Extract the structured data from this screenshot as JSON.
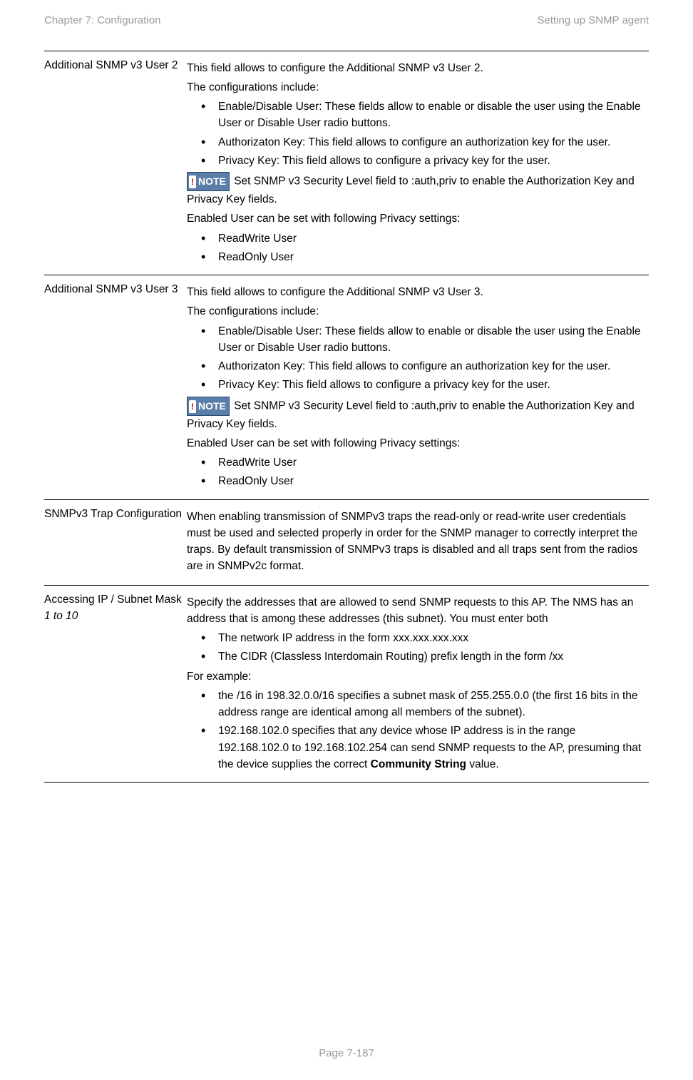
{
  "header": {
    "left": "Chapter 7:  Configuration",
    "right": "Setting up SNMP agent"
  },
  "noteBadge": {
    "exclaim": "!",
    "text": "NOTE"
  },
  "rows": [
    {
      "label": "Additional SNMP v3 User 2",
      "p1": "This field allows to configure the Additional SNMP v3 User 2.",
      "p2": "The configurations include:",
      "b1": "Enable/Disable User: These fields allow to enable or disable the user using the Enable User or Disable User radio buttons.",
      "b2": "Authorizaton Key: This field allows to configure an authorization key for the user.",
      "b3": "Privacy Key: This field allows to configure a privacy key for the user.",
      "noteText": " Set SNMP v3 Security Level field to :auth,priv to enable the Authorization Key and Privacy Key fields.",
      "p3": "Enabled User can be set with following Privacy settings:",
      "b4": "ReadWrite User",
      "b5": "ReadOnly User"
    },
    {
      "label": "Additional SNMP v3 User 3",
      "p1": "This field allows to configure the Additional SNMP v3 User 3.",
      "p2": "The configurations include:",
      "b1": "Enable/Disable User: These fields allow to enable or disable the user using the Enable User or Disable User radio buttons.",
      "b2": "Authorizaton Key: This field allows to configure an authorization key for the user.",
      "b3": "Privacy Key: This field allows to configure a privacy key for the user.",
      "noteText": " Set SNMP v3 Security Level field to :auth,priv to enable the Authorization Key and Privacy Key fields.",
      "p3": "Enabled User can be set with following Privacy settings:",
      "b4": "ReadWrite User",
      "b5": "ReadOnly User"
    },
    {
      "label": "SNMPv3 Trap Configuration",
      "p1": "When enabling transmission of SNMPv3 traps the read-only or read-write user credentials must be used and selected properly in order for the SNMP manager to correctly interpret the traps. By default transmission of SNMPv3 traps is disabled and all traps sent from the radios are in SNMPv2c format."
    },
    {
      "labelA": "Accessing IP / Subnet Mask ",
      "labelB": "1 to 10",
      "p1": "Specify the addresses that are allowed to send SNMP requests to this AP. The NMS has an address that is among these addresses (this subnet). You must enter both",
      "b1": "The network IP address in the form xxx.xxx.xxx.xxx",
      "b2": "The CIDR (Classless Interdomain Routing) prefix length in the form /xx",
      "p2": "For example:",
      "b3": "the /16 in 198.32.0.0/16 specifies a subnet mask of 255.255.0.0 (the first 16 bits in the address range are identical among all members of the subnet).",
      "b4a": "192.168.102.0 specifies that any device whose IP address is in the range 192.168.102.0 to 192.168.102.254 can send SNMP requests to the AP, presuming that the device supplies the correct ",
      "b4bold": "Community String",
      "b4b": " value."
    }
  ],
  "footer": "Page 7-187"
}
